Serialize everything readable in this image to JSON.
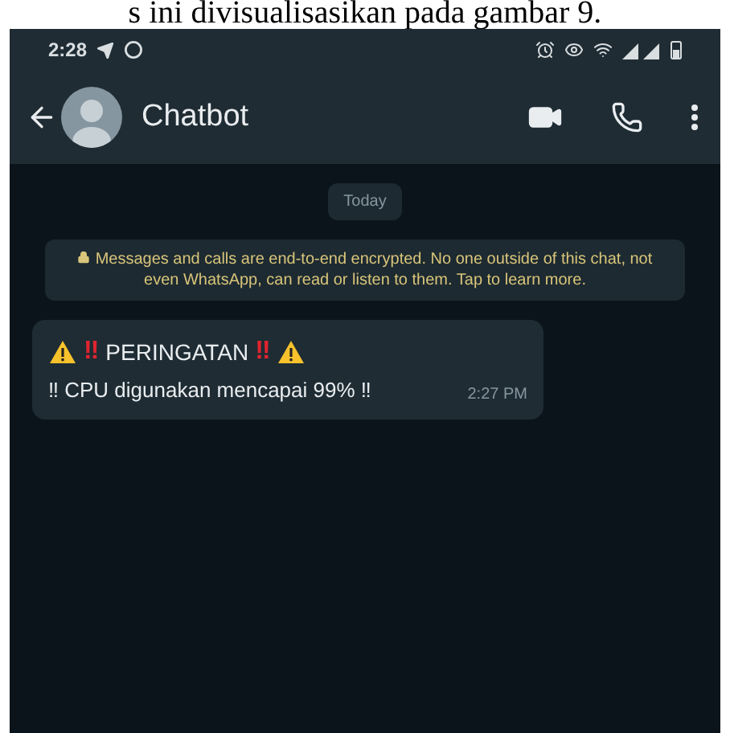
{
  "document_caption": "s ini divisualisasikan pada gambar 9.",
  "status_bar": {
    "time": "2:28"
  },
  "header": {
    "title": "Chatbot"
  },
  "date_chip": "Today",
  "encryption_notice": "Messages and calls are end-to-end encrypted. No one outside of this chat, not even WhatsApp, can read or listen to them. Tap to learn more.",
  "message": {
    "title_segments": [
      {
        "kind": "warning"
      },
      {
        "kind": "bangbang",
        "text": "‼"
      },
      {
        "kind": "text",
        "text": "PERINGATAN"
      },
      {
        "kind": "bangbang",
        "text": "‼"
      },
      {
        "kind": "warning"
      }
    ],
    "body": "‼ CPU digunakan mencapai 99% ‼",
    "time": "2:27 PM"
  }
}
